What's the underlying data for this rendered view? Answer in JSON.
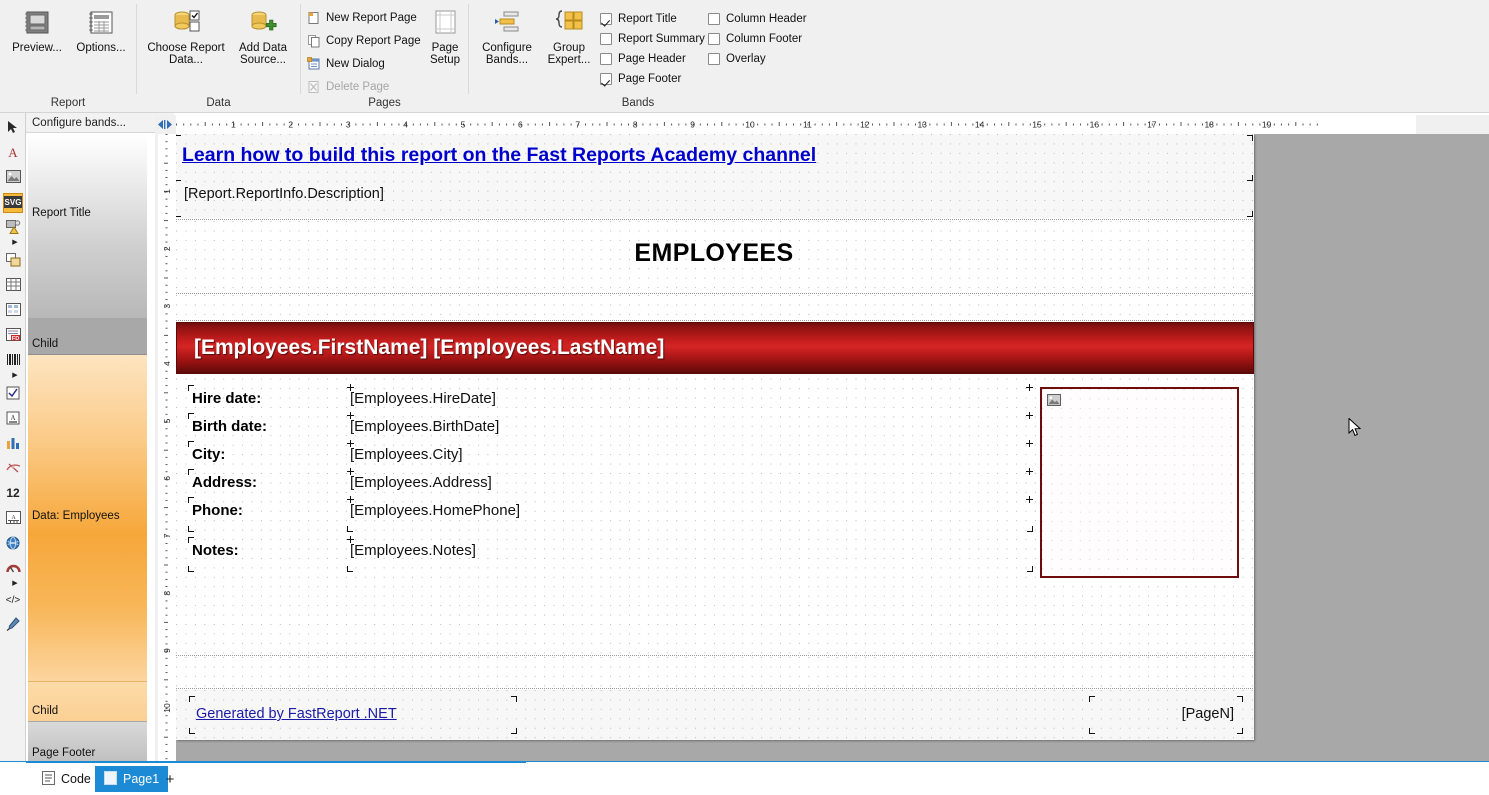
{
  "ribbon": {
    "groups": [
      {
        "caption": "Report",
        "buttons": [
          {
            "label": "Preview...",
            "icon": "preview-icon"
          },
          {
            "label": "Options...",
            "icon": "options-icon"
          }
        ]
      },
      {
        "caption": "Data",
        "buttons": [
          {
            "label": "Choose Report Data...",
            "icon": "database-check-icon"
          },
          {
            "label": "Add Data Source...",
            "icon": "database-plus-icon"
          }
        ]
      },
      {
        "caption": "Pages",
        "items": [
          {
            "label": "New Report Page",
            "icon": "new-page-icon",
            "disabled": false
          },
          {
            "label": "Copy Report Page",
            "icon": "copy-page-icon",
            "disabled": false
          },
          {
            "label": "New Dialog",
            "icon": "new-dialog-icon",
            "disabled": false
          },
          {
            "label": "Delete Page",
            "icon": "delete-page-icon",
            "disabled": true
          }
        ],
        "page_setup_label": "Page Setup",
        "page_setup_icon": "page-setup-icon"
      },
      {
        "caption": "Bands",
        "buttons": [
          {
            "label": "Configure Bands...",
            "icon": "configure-bands-icon"
          },
          {
            "label": "Group Expert...",
            "icon": "group-expert-icon"
          }
        ],
        "checkboxes": [
          {
            "label": "Report Title",
            "checked": true
          },
          {
            "label": "Report Summary",
            "checked": false
          },
          {
            "label": "Page Header",
            "checked": false
          },
          {
            "label": "Page Footer",
            "checked": true
          },
          {
            "label": "Column Header",
            "checked": false
          },
          {
            "label": "Column Footer",
            "checked": false
          },
          {
            "label": "Overlay",
            "checked": false
          }
        ]
      }
    ]
  },
  "toolbox": {
    "tools": [
      {
        "name": "select-pointer-tool",
        "icon": "pointer-icon"
      },
      {
        "name": "text-tool",
        "icon": "text-a-icon"
      },
      {
        "name": "picture-tool",
        "icon": "picture-icon"
      },
      {
        "name": "svg-tool",
        "icon": "svg-icon"
      },
      {
        "name": "shape-tool",
        "icon": "shape-warning-icon"
      },
      {
        "name": "subreport-tool",
        "icon": "subreport-icon"
      },
      {
        "name": "table-tool",
        "icon": "table-icon"
      },
      {
        "name": "matrix-tool",
        "icon": "matrix-icon"
      },
      {
        "name": "rich-text-tool",
        "icon": "richtext-fd-icon"
      },
      {
        "name": "barcode-tool",
        "icon": "barcode-icon"
      },
      {
        "name": "checkbox-tool",
        "icon": "checkbox-icon"
      },
      {
        "name": "line-tool",
        "icon": "line-a-icon"
      },
      {
        "name": "chart-tool",
        "icon": "chart-icon"
      },
      {
        "name": "gauge-tool",
        "icon": "gauge-icon"
      },
      {
        "name": "digits-tool",
        "icon": "digits-12-icon"
      },
      {
        "name": "zipcode-tool",
        "icon": "zipcode-icon"
      },
      {
        "name": "map-tool",
        "icon": "globe-icon"
      },
      {
        "name": "gauge-linear-tool",
        "icon": "gauge-arc-icon"
      },
      {
        "name": "html-tool",
        "icon": "html-code-icon"
      },
      {
        "name": "format-painter-tool",
        "icon": "format-painter-icon"
      }
    ]
  },
  "bands_panel": {
    "header_label": "Configure bands...",
    "bands": [
      {
        "label": "Report Title",
        "kind": "title"
      },
      {
        "label": "Child",
        "kind": "child"
      },
      {
        "label": "Data: Employees",
        "kind": "data"
      },
      {
        "label": "Child",
        "kind": "child2"
      },
      {
        "label": "Page Footer",
        "kind": "footer"
      }
    ]
  },
  "rulers": {
    "horizontal_ticks": [
      "1",
      "2",
      "3",
      "4",
      "5",
      "6",
      "7",
      "8",
      "9",
      "10",
      "11",
      "12",
      "13",
      "14",
      "15",
      "16",
      "17",
      "18",
      "19"
    ],
    "vertical_ticks": [
      "1",
      "2",
      "3",
      "4",
      "5",
      "6",
      "7",
      "8",
      "9",
      "10"
    ]
  },
  "report": {
    "title_link": "Learn how to build this report on the Fast Reports Academy channel",
    "description_field": "[Report.ReportInfo.Description]",
    "heading": "EMPLOYEES",
    "name_band": "[Employees.FirstName] [Employees.LastName]",
    "fields": [
      {
        "label": "Hire date:",
        "value": "[Employees.HireDate]"
      },
      {
        "label": "Birth date:",
        "value": "[Employees.BirthDate]"
      },
      {
        "label": "City:",
        "value": "[Employees.City]"
      },
      {
        "label": "Address:",
        "value": "[Employees.Address]"
      },
      {
        "label": "Phone:",
        "value": "[Employees.HomePhone]"
      }
    ],
    "notes": {
      "label": "Notes:",
      "value": "[Employees.Notes]"
    },
    "picture_placeholder_icon": "picture-icon",
    "footer_link": "Generated by FastReport .NET",
    "footer_page_number": "[PageN]"
  },
  "tabs": {
    "items": [
      {
        "label": "Code",
        "icon": "code-page-icon",
        "active": false
      },
      {
        "label": "Page1",
        "icon": "page-icon",
        "active": true
      }
    ],
    "add_label": "+"
  },
  "colors": {
    "accent": "#1c8ad4",
    "band_red": "#c41d1d",
    "link_blue": "#0000cc",
    "data_band": "#f4a83c"
  }
}
